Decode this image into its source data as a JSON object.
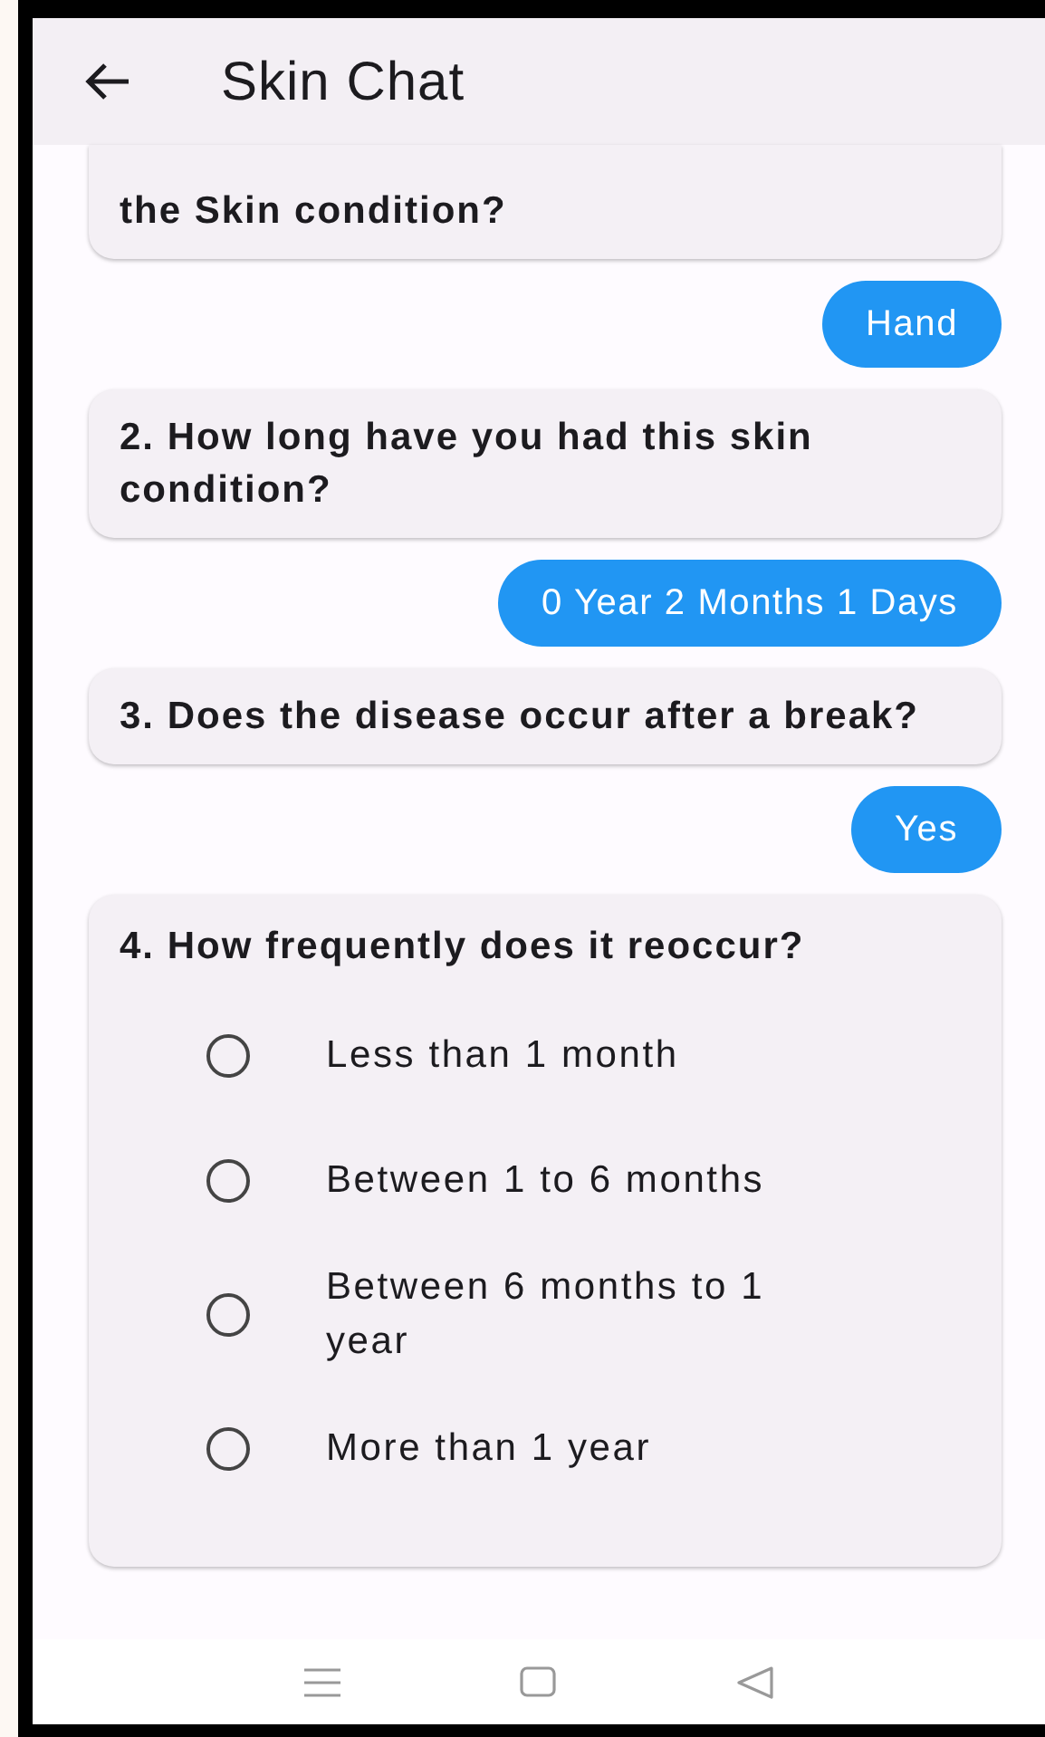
{
  "app_bar": {
    "title": "Skin Chat"
  },
  "messages": [
    {
      "kind": "question",
      "text": "the Skin condition?",
      "clipped": true
    },
    {
      "kind": "answer",
      "text": "Hand"
    },
    {
      "kind": "question",
      "text": "2. How long have you had this skin condition?",
      "clipped": false
    },
    {
      "kind": "answer",
      "text": "0 Year 2 Months 1 Days"
    },
    {
      "kind": "question",
      "text": "3. Does the disease occur after a break?",
      "clipped": false
    },
    {
      "kind": "answer",
      "text": "Yes"
    },
    {
      "kind": "choice",
      "text": "4. How frequently does it reoccur?",
      "options": [
        {
          "label": "Less than 1 month",
          "selected": false
        },
        {
          "label": "Between 1 to 6 months",
          "selected": false
        },
        {
          "label": "Between 6 months to 1 year",
          "selected": false
        },
        {
          "label": "More than 1 year",
          "selected": false
        }
      ]
    }
  ]
}
